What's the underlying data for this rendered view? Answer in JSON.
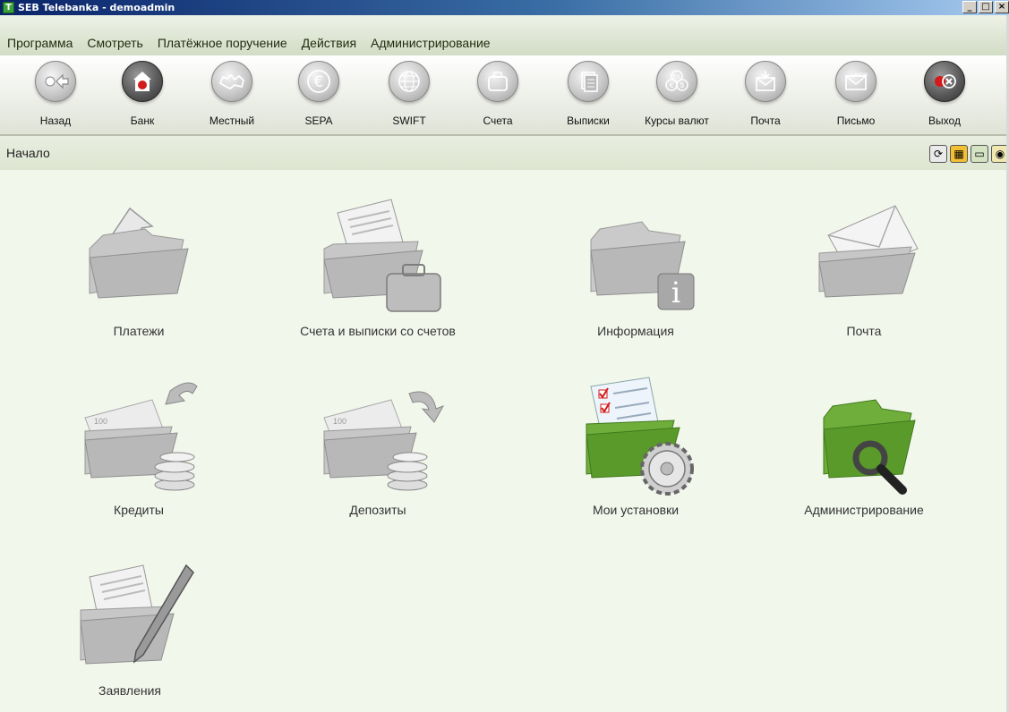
{
  "window": {
    "title": "SEB Telebanka - demoadmin",
    "app_icon_letter": "T",
    "controls": [
      "_",
      "□",
      "×"
    ]
  },
  "menu": [
    "Программа",
    "Смотреть",
    "Платёжное поручение",
    "Действия",
    "Администрирование"
  ],
  "toolbar": [
    {
      "label": "Назад",
      "icon": "back-arrow-icon"
    },
    {
      "label": "Банк",
      "icon": "bank-icon"
    },
    {
      "label": "Местный",
      "icon": "latvia-map-icon"
    },
    {
      "label": "SEPA",
      "icon": "euro-icon"
    },
    {
      "label": "SWIFT",
      "icon": "globe-icon"
    },
    {
      "label": "Счета",
      "icon": "briefcase-icon"
    },
    {
      "label": "Выписки",
      "icon": "documents-icon"
    },
    {
      "label": "Курсы валют",
      "icon": "currency-icon"
    },
    {
      "label": "Почта",
      "icon": "mail-inbox-icon"
    },
    {
      "label": "Письмо",
      "icon": "new-letter-icon"
    },
    {
      "label": "Выход",
      "icon": "exit-icon"
    }
  ],
  "breadcrumb": "Начало",
  "tiles": [
    {
      "label": "Платежи",
      "icon": "payments-folder-icon"
    },
    {
      "label": "Счета и выписки со счетов",
      "icon": "accounts-folder-icon"
    },
    {
      "label": "Информация",
      "icon": "info-folder-icon"
    },
    {
      "label": "Почта",
      "icon": "mail-folder-icon"
    },
    {
      "label": "Кредиты",
      "icon": "credits-folder-icon"
    },
    {
      "label": "Депозиты",
      "icon": "deposits-folder-icon"
    },
    {
      "label": "Мои установки",
      "icon": "settings-folder-icon"
    },
    {
      "label": "Администрирование",
      "icon": "admin-folder-icon"
    },
    {
      "label": "Заявления",
      "icon": "applications-folder-icon"
    }
  ],
  "colors": {
    "title_bar": "#0a246a",
    "menu_bg": "#dfe7d3",
    "content_bg": "#f2f7ec",
    "active_green": "#5a9a2a",
    "red_accent": "#d41a1a"
  }
}
